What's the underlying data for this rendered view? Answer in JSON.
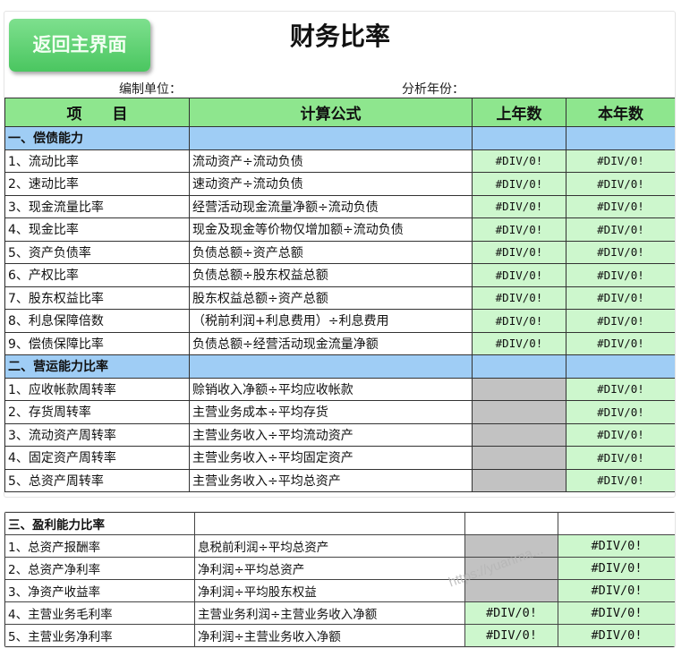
{
  "header": {
    "back_button": "返回主界面",
    "title": "财务比率",
    "unit_label": "编制单位：",
    "year_label": "分析年份："
  },
  "columns": [
    "项　　目",
    "计算公式",
    "上年数",
    "本年数"
  ],
  "sections": [
    {
      "title": "一、偿债能力",
      "rows": [
        {
          "item": "1、流动比率",
          "formula": "流动资产÷流动负债",
          "prev": "#DIV/0!",
          "curr": "#DIV/0!"
        },
        {
          "item": "2、速动比率",
          "formula": "速动资产÷流动负债",
          "prev": "#DIV/0!",
          "curr": "#DIV/0!"
        },
        {
          "item": "3、现金流量比率",
          "formula": "经营活动现金流量净额÷流动负债",
          "prev": "#DIV/0!",
          "curr": "#DIV/0!"
        },
        {
          "item": "4、现金比率",
          "formula": "现金及现金等价物仅增加额÷流动负债",
          "prev": "#DIV/0!",
          "curr": "#DIV/0!"
        },
        {
          "item": "5、资产负债率",
          "formula": "负债总额÷资产总额",
          "prev": "#DIV/0!",
          "curr": "#DIV/0!"
        },
        {
          "item": "6、产权比率",
          "formula": "负债总额÷股东权益总额",
          "prev": "#DIV/0!",
          "curr": "#DIV/0!"
        },
        {
          "item": "7、股东权益比率",
          "formula": "股东权益总额÷资产总额",
          "prev": "#DIV/0!",
          "curr": "#DIV/0!"
        },
        {
          "item": "8、利息保障倍数",
          "formula": "（税前利润+利息费用）÷利息费用",
          "prev": "#DIV/0!",
          "curr": "#DIV/0!"
        },
        {
          "item": "9、偿债保障比率",
          "formula": "负债总额÷经营活动现金流量净额",
          "prev": "#DIV/0!",
          "curr": "#DIV/0!"
        }
      ]
    },
    {
      "title": "二、营运能力比率",
      "rows": [
        {
          "item": "1、应收帐款周转率",
          "formula": "赊销收入净额÷平均应收帐款",
          "prev": "",
          "curr": "#DIV/0!"
        },
        {
          "item": "2、存货周转率",
          "formula": "主营业务成本÷平均存货",
          "prev": "",
          "curr": "#DIV/0!"
        },
        {
          "item": "3、流动资产周转率",
          "formula": "主营业务收入÷平均流动资产",
          "prev": "",
          "curr": "#DIV/0!"
        },
        {
          "item": "4、固定资产周转率",
          "formula": "主营业务收入÷平均固定资产",
          "prev": "",
          "curr": "#DIV/0!"
        },
        {
          "item": "5、总资产周转率",
          "formula": "主营业务收入÷平均总资产",
          "prev": "",
          "curr": "#DIV/0!"
        }
      ]
    },
    {
      "title": "三、盈利能力比率",
      "rows": [
        {
          "item": "1、总资产报酬率",
          "formula": "息税前利润÷平均总资产",
          "prev": "",
          "curr": "#DIV/0!"
        },
        {
          "item": "2、总资产净利率",
          "formula": "净利润÷平均总资产",
          "prev": "",
          "curr": "#DIV/0!"
        },
        {
          "item": "3、净资产收益率",
          "formula": "净利润÷平均股东权益",
          "prev": "",
          "curr": "#DIV/0!"
        },
        {
          "item": "4、主营业务毛利率",
          "formula": "主营业务利润÷主营业务收入净额",
          "prev": "#DIV/0!",
          "curr": "#DIV/0!"
        },
        {
          "item": "5、主营业务净利率",
          "formula": "净利润÷主营业务收入净额",
          "prev": "#DIV/0!",
          "curr": "#DIV/0!"
        }
      ]
    }
  ],
  "watermark": "https://yuanma..."
}
